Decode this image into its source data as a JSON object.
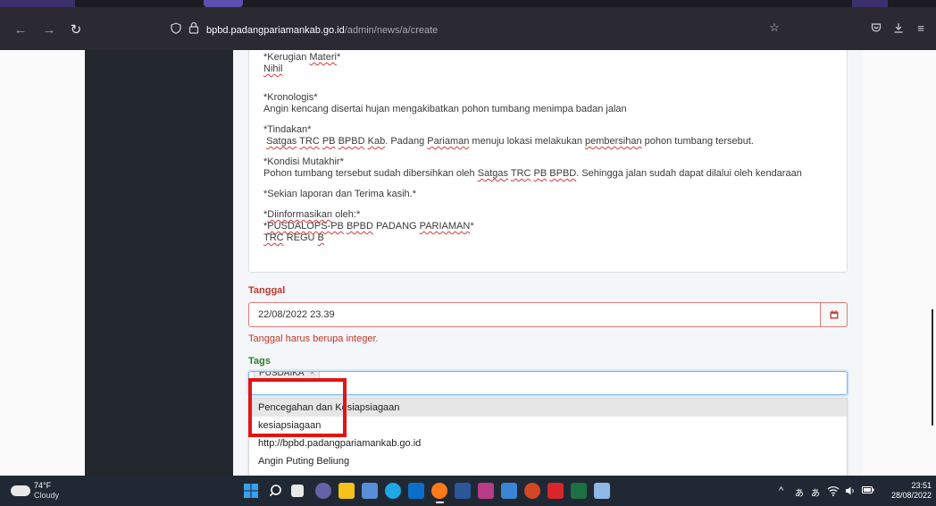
{
  "browser": {
    "url_host": "bpbd.padangpariamankab.go.id",
    "url_path": "/admin/news/a/create"
  },
  "editor": {
    "kerugian_title": "*Kerugian Materi*",
    "kerugian_value": "Nihil",
    "kronologis_title": "*Kronologis*",
    "kronologis_value": "Angin kencang disertai hujan mengakibatkan pohon tumbang menimpa badan jalan",
    "tindakan_title": "*Tindakan*",
    "tindakan_value": " Satgas TRC PB BPBD Kab. Padang Pariaman menuju lokasi melakukan pembersihan pohon tumbang tersebut.",
    "kondisi_title": "*Kondisi Mutakhir*",
    "kondisi_value": "Pohon tumbang tersebut sudah dibersihkan oleh Satgas TRC PB BPBD. Sehingga jalan sudah dapat dilalui oleh kendaraan",
    "closing": "*Sekian laporan dan Terima kasih.*",
    "info_title": "*Diinformasikan oleh:*",
    "info_org": "*PUSDALOPS-PB BPBD PADANG PARIAMAN*",
    "info_team": "TRC REGU B"
  },
  "form": {
    "tanggal_label": "Tanggal",
    "tanggal_value": "22/08/2022 23.39",
    "tanggal_error": "Tanggal harus berupa integer.",
    "tags_label": "Tags",
    "tag_chip": "PUSDAIKA",
    "tag_remove": "×",
    "suggestions": [
      "Pencegahan dan Kesiapsiagaan",
      "kesiapsiagaan",
      "http://bpbd.padangpariamankab.go.id",
      "Angin Puting Beliung"
    ]
  },
  "taskbar": {
    "temp": "74°F",
    "condition": "Cloudy",
    "time": "23:51",
    "date": "28/08/2022"
  },
  "colors": {
    "error": "#c0392b",
    "tags_label": "#2e7d32",
    "highlight_box": "#e31414"
  }
}
